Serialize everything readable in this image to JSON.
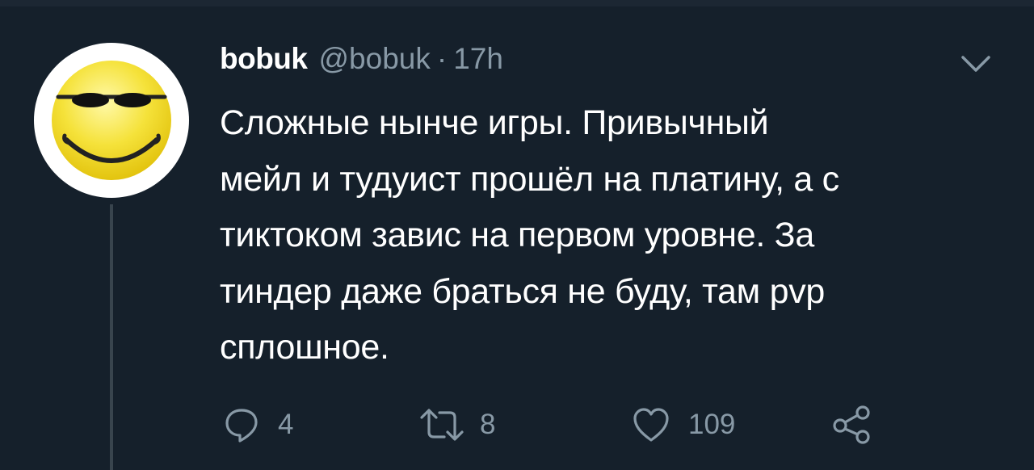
{
  "tweet": {
    "display_name": "bobuk",
    "handle": "@bobuk",
    "separator": "·",
    "time": "17h",
    "text": "Сложные нынче игры. Привычный\nмейл и тудуист прошёл на платину, а с\nтиктоком завис на первом уровне. За\nтиндер даже браться не буду, там pvp\nсплошное."
  },
  "avatar": {
    "icon": "smiley-sunglasses-icon"
  },
  "actions": {
    "reply_count": "4",
    "retweet_count": "8",
    "like_count": "109",
    "reply_icon": "reply-icon",
    "retweet_icon": "retweet-icon",
    "like_icon": "heart-icon",
    "share_icon": "share-icon"
  },
  "colors": {
    "background": "#15202b",
    "primary_text": "#ffffff",
    "secondary_text": "#8899a6",
    "thread_line": "#38444d"
  }
}
